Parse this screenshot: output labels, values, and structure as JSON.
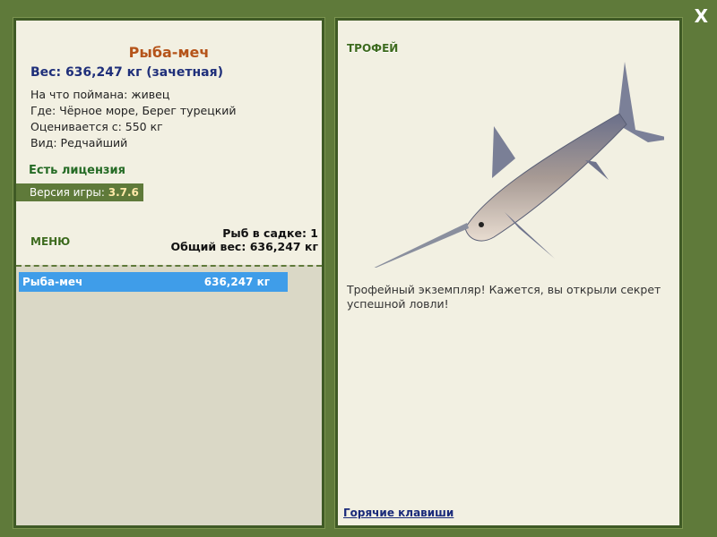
{
  "close": {
    "label": "X"
  },
  "fish": {
    "name": "Рыба-меч",
    "weight_line": "Вес: 636,247 кг (зачетная)",
    "bait": "На что поймана: живец",
    "location": "Где: Чёрное море, Берег турецкий",
    "rated_from": "Оценивается с: 550 кг",
    "rarity": "Вид: Редчайший"
  },
  "license": "Есть лицензия",
  "version": {
    "label": "Версия игры:",
    "value": "3.7.6"
  },
  "menu": {
    "label": "МЕНЮ"
  },
  "stats": {
    "fish_count": "Рыб в садке: 1",
    "total_weight": "Общий вес: 636,247 кг"
  },
  "keepnet": [
    {
      "name": "Рыба-меч",
      "weight": "636,247 кг"
    }
  ],
  "trophy": {
    "label": "ТРОФЕЙ",
    "image_icon": "swordfish-image",
    "text": "Трофейный экземпляр! Кажется, вы открыли секрет успешной ловли!"
  },
  "hotkeys_link": "Горячие клавиши",
  "colors": {
    "background": "#5f7a3a",
    "panel": "#f2f0e2",
    "selected_row": "#3f9de9",
    "fish_title": "#b5541a",
    "weight_text": "#1f2f7a"
  }
}
